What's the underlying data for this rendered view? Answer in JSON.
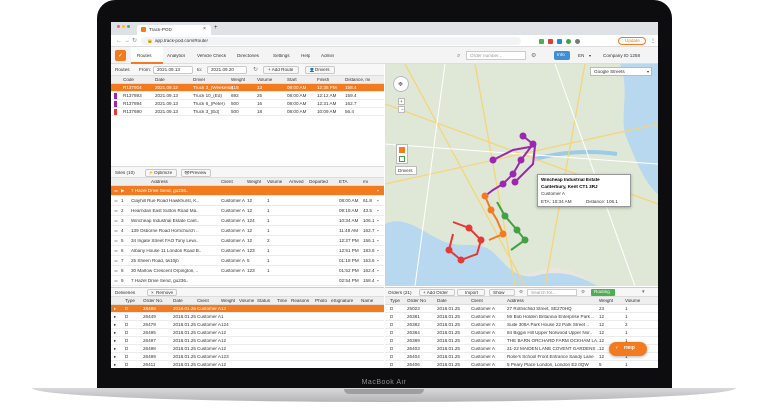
{
  "browser": {
    "tab_title": "Track-POD",
    "url": "app.track-pod.com/Route/",
    "update_label": "Update"
  },
  "nav": {
    "items": [
      "Routes",
      "Analytics",
      "Vehicle Check",
      "Directories",
      "Settings",
      "Help",
      "Admin"
    ],
    "search_placeholder": "Order number...",
    "info_label": "Info",
    "lang": "EN",
    "company": "Company ID 1258"
  },
  "routes": {
    "title": "Routes",
    "from_label": "From:",
    "from_date": "2021.09.13",
    "to_label": "to:",
    "to_date": "2021.09.20",
    "add_label": "+ Add Route",
    "drivers_label": "Drivers",
    "columns": [
      "Code",
      "Date",
      "Driver",
      "Weight",
      "Volume",
      "Start",
      "Finish",
      "Distance, mi"
    ],
    "rows": [
      [
        "R137904",
        "2021.09.12",
        "Truck 3_(Weekend)",
        "418",
        "13",
        "08:00 AM",
        "12:35 PM",
        "158.4"
      ],
      [
        "R137893",
        "2021.09.13",
        "Truck 10_(Ed)",
        "692",
        "25",
        "08:00 AM",
        "12:12 AM",
        "159.4"
      ],
      [
        "R137894",
        "2021.09.13",
        "Truck 6_(Peter)",
        "500",
        "16",
        "08:00 AM",
        "12:31 AM",
        "162.7"
      ],
      [
        "R137690",
        "2021.09.13",
        "Truck 3_(Ed)",
        "500",
        "18",
        "08:00 AM",
        "10:09 AM",
        "56.4"
      ]
    ],
    "row_colors": [
      "#f47a20",
      "#9c27b0",
      "#9c27b0",
      "#e53935"
    ]
  },
  "sites": {
    "title": "Sites (10)",
    "optimize_label": "Optimize",
    "preview_label": "Preview",
    "columns": [
      "Address",
      "Client",
      "Weight",
      "Volume",
      "Arrived",
      "Departed",
      "ETA",
      "mi"
    ],
    "rows": [
      [
        "7 Hazel Drive Send, gu236..",
        "",
        "",
        "",
        "",
        "",
        "",
        ""
      ],
      [
        "Clayhill Rue Road Hawkhurst, K..",
        "Customer A",
        "12",
        "1",
        "",
        "",
        "08:00 AM",
        "61.8"
      ],
      [
        "Hearndan East Sutton Road Ma..",
        "Customer A",
        "12",
        "1",
        "",
        "",
        "09:18 AM",
        "43.5"
      ],
      [
        "Wincheap Industrial Estate Cant..",
        "Customer A",
        "124",
        "1",
        "",
        "",
        "10:34 AM",
        "106.1"
      ],
      [
        "139 Osborne Road Hornchurch ..",
        "Customer A",
        "12",
        "1",
        "",
        "",
        "11:48 AM",
        "162.7"
      ],
      [
        "34 Ingate Street FAO Tony Lewi..",
        "Customer A",
        "12",
        "2",
        "",
        "",
        "12:27 PM",
        "156.1"
      ],
      [
        "Albany House 11 London Road B..",
        "Customer A",
        "123",
        "1",
        "",
        "",
        "12:51 PM",
        "183.6"
      ],
      [
        "25 Sheen Road, tw10jb",
        "Customer A",
        "5",
        "1",
        "",
        "",
        "01:18 PM",
        "153.6"
      ],
      [
        "30 Marlow Crescent Orpington, ..",
        "Customer A",
        "123",
        "1",
        "",
        "",
        "01:52 PM",
        "162.4"
      ],
      [
        "7 Hazel Drive Send, gu236..",
        "",
        "",
        "",
        "",
        "",
        "02:54 PM",
        "158.4"
      ]
    ]
  },
  "map": {
    "style": "Google Streets",
    "drivers_label": "Drivers",
    "tooltip_title": "Wincheap Industrial Estate",
    "tooltip_addr": "Canterbury, Kent CT1 3RJ",
    "tooltip_client": "Customer A",
    "tooltip_eta": "ETA: 10:34 AM",
    "tooltip_dist": "Distance: 106.1"
  },
  "deliveries": {
    "title": "Deliveries",
    "remove_label": "Remove",
    "columns": [
      "Type",
      "Order No.",
      "Date",
      "Client",
      "Weight",
      "Volume",
      "Status",
      "Time",
      "Reasons",
      "Photo",
      "eSignature",
      "Name"
    ],
    "rows": [
      [
        "D",
        "28488",
        "2018.01.25",
        "Customer A",
        "12"
      ],
      [
        "D",
        "26449",
        "2018.01.25",
        "Customer A",
        "1"
      ],
      [
        "D",
        "26479",
        "2018.01.25",
        "Customer A",
        "124"
      ],
      [
        "D",
        "26495",
        "2018.01.25",
        "Customer A",
        "12"
      ],
      [
        "D",
        "26497",
        "2018.01.25",
        "Customer A",
        "12"
      ],
      [
        "D",
        "26498",
        "2018.01.25",
        "Customer A",
        "12"
      ],
      [
        "D",
        "26499",
        "2018.01.25",
        "Customer A",
        "123"
      ],
      [
        "D",
        "26411",
        "2018.01.25",
        "Customer A",
        "12"
      ],
      [
        "D",
        "26412",
        "2018.01.25",
        "Customer A",
        "123"
      ]
    ]
  },
  "orders": {
    "title": "Orders (21)",
    "add_label": "+ Add Order",
    "import_label": "Import",
    "show_label": "Show",
    "search_placeholder": "Search for...",
    "routing_label": "Routing",
    "help_label": "Help",
    "columns": [
      "Type",
      "Order No",
      "Date",
      "Client",
      "Address",
      "Weight",
      "Volume"
    ],
    "rows": [
      [
        "D",
        "25023",
        "2018.01.25",
        "Customer A",
        "27 Rothschild Street, SE270HQ",
        "23",
        "1"
      ],
      [
        "D",
        "26381",
        "2018.01.25",
        "Customer A",
        "Mr Bob Holden Britannia Enterprise Park ..",
        "12",
        "1"
      ],
      [
        "D",
        "26382",
        "2018.01.25",
        "Customer A",
        "Suite 309A Park House 22 Park Street ..",
        "12",
        "2"
      ],
      [
        "D",
        "26384",
        "2018.01.25",
        "Customer A",
        "84 Biggin Hill Upper Norwood Upper Nor..",
        "12",
        "1"
      ],
      [
        "D",
        "26389",
        "2018.01.25",
        "Customer A",
        "THE BARN ORCHARD FARM OCKHAM LA..",
        "12",
        "1"
      ],
      [
        "D",
        "26403",
        "2018.01.25",
        "Customer A",
        "21-22 MAIDEN LANE COVENT GARDENS ..",
        "12",
        "1"
      ],
      [
        "D",
        "26404",
        "2018.01.25",
        "Customer A",
        "Rose's School Front Entrance Sandy Lane",
        "12",
        "1"
      ],
      [
        "D",
        "26406",
        "2018.01.25",
        "Customer A",
        "5 Peary Place London, London E2 0QW",
        "5",
        "1"
      ]
    ]
  },
  "device": {
    "label": "MacBook Air"
  }
}
